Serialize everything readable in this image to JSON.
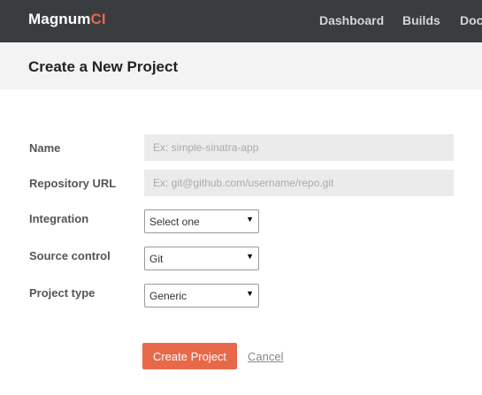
{
  "brand": {
    "name_main": "Magnum",
    "name_accent": "CI",
    "accent_color": "#e8684a"
  },
  "nav": {
    "items": [
      "Dashboard",
      "Builds",
      "Docs"
    ]
  },
  "page": {
    "title": "Create a New Project"
  },
  "form": {
    "name": {
      "label": "Name",
      "value": "",
      "placeholder": "Ex: simple-sinatra-app"
    },
    "repository_url": {
      "label": "Repository URL",
      "value": "",
      "placeholder": "Ex: git@github.com/username/repo.git"
    },
    "integration": {
      "label": "Integration",
      "selected": "Select one"
    },
    "source_control": {
      "label": "Source control",
      "selected": "Git"
    },
    "project_type": {
      "label": "Project type",
      "selected": "Generic"
    },
    "submit_label": "Create Project",
    "cancel_label": "Cancel"
  },
  "icons": {
    "select_caret": "▼"
  }
}
